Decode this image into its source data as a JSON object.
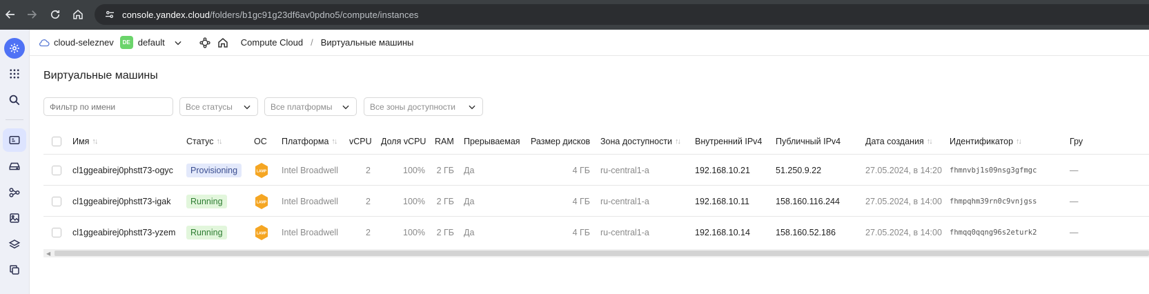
{
  "browser": {
    "url_host": "console.yandex.cloud",
    "url_path": "/folders/b1gc91g23df6av0pdno5/compute/instances"
  },
  "header": {
    "cloud_name": "cloud-seleznev",
    "folder_badge": "DE",
    "folder_name": "default",
    "breadcrumb": [
      "Compute Cloud",
      "Виртуальные машины"
    ],
    "crumb_separator": "/"
  },
  "page": {
    "title": "Виртуальные машины"
  },
  "filters": {
    "name_placeholder": "Фильтр по имени",
    "status": "Все статусы",
    "platform": "Все платформы",
    "zone": "Все зоны доступности"
  },
  "table": {
    "columns": {
      "name": "Имя",
      "status": "Статус",
      "os": "ОС",
      "platform": "Платформа",
      "vcpu": "vCPU",
      "vcpu_share": "Доля vCPU",
      "ram": "RAM",
      "preemptible": "Прерываемая",
      "disk_size": "Размер дисков",
      "zone": "Зона доступности",
      "internal_ip": "Внутренний IPv4",
      "public_ip": "Публичный IPv4",
      "created": "Дата создания",
      "id": "Идентификатор",
      "group": "Гру"
    },
    "os_label": "LAMP",
    "rows": [
      {
        "name": "cl1ggeabirej0phstt73-ogyc",
        "status": "Provisioning",
        "platform": "Intel Broadwell",
        "vcpu": "2",
        "vcpu_share": "100%",
        "ram": "2 ГБ",
        "preemptible": "Да",
        "disk_size": "4 ГБ",
        "zone": "ru-central1-a",
        "internal_ip": "192.168.10.21",
        "public_ip": "51.250.9.22",
        "created": "27.05.2024, в 14:20",
        "id": "fhmnvbj1s09nsg3gfmgc",
        "group": "—"
      },
      {
        "name": "cl1ggeabirej0phstt73-igak",
        "status": "Running",
        "platform": "Intel Broadwell",
        "vcpu": "2",
        "vcpu_share": "100%",
        "ram": "2 ГБ",
        "preemptible": "Да",
        "disk_size": "4 ГБ",
        "zone": "ru-central1-a",
        "internal_ip": "192.168.10.11",
        "public_ip": "158.160.116.244",
        "created": "27.05.2024, в 14:00",
        "id": "fhmpqhm39rn0c9vnjgss",
        "group": "—"
      },
      {
        "name": "cl1ggeabirej0phstt73-yzem",
        "status": "Running",
        "platform": "Intel Broadwell",
        "vcpu": "2",
        "vcpu_share": "100%",
        "ram": "2 ГБ",
        "preemptible": "Да",
        "disk_size": "4 ГБ",
        "zone": "ru-central1-a",
        "internal_ip": "192.168.10.14",
        "public_ip": "158.160.52.186",
        "created": "27.05.2024, в 14:00",
        "id": "fhmqq0qqng96s2eturk2",
        "group": "—"
      }
    ]
  },
  "colors": {
    "provisioning_bg": "#e3e9fb",
    "provisioning_fg": "#3a4d8f",
    "running_bg": "#e2f6dc",
    "running_fg": "#2e7d32",
    "lamp_orange": "#f5a623",
    "rail_accent": "#4f72f5"
  },
  "icons": [
    "back-arrow-icon",
    "forward-arrow-icon",
    "reload-icon",
    "home-icon",
    "site-settings-icon",
    "settings-gear-icon",
    "apps-grid-icon",
    "search-icon",
    "server-icon",
    "storage-icon",
    "network-icon",
    "image-icon",
    "layers-icon",
    "copy-icon",
    "cloud-icon",
    "chevron-down-icon",
    "tree-nodes-icon",
    "home-icon",
    "sort-icon",
    "lamp-icon"
  ]
}
